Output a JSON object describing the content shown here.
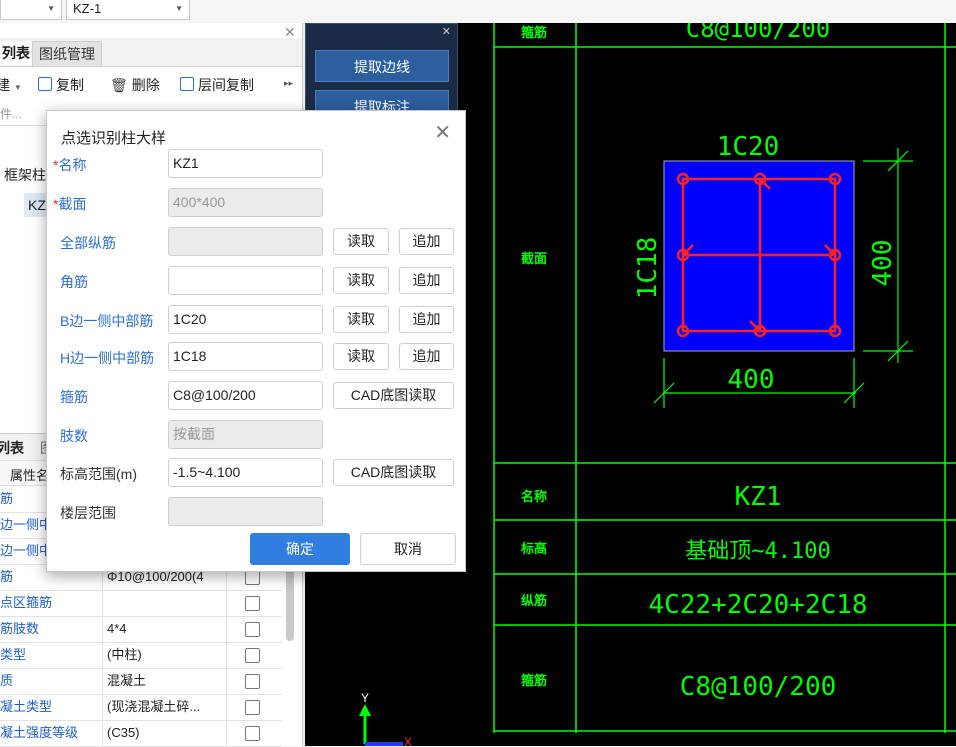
{
  "topbar": {
    "combo1_value": "",
    "combo2_value": "KZ-1"
  },
  "left_panel": {
    "tabs": [
      "列表",
      "图纸管理"
    ],
    "toolbar": [
      "建",
      "复制",
      "删除",
      "层间复制"
    ],
    "search_placeholder": "件...",
    "tree": {
      "group": "框架柱",
      "item": "KZ"
    },
    "tabs2": [
      "列表",
      "图"
    ],
    "prop_header": "属性名",
    "props": [
      {
        "name": "筋",
        "value": "",
        "checked": false
      },
      {
        "name": "边一侧中",
        "value": "",
        "checked": false
      },
      {
        "name": "边一侧中",
        "value": "",
        "checked": false
      },
      {
        "name": "筋",
        "value": "Φ10@100/200(4",
        "checked": false
      },
      {
        "name": "点区箍筋",
        "value": "",
        "checked": false
      },
      {
        "name": "筋肢数",
        "value": "4*4",
        "checked": false
      },
      {
        "name": "类型",
        "value": "(中柱)",
        "checked": false
      },
      {
        "name": "质",
        "value": "混凝土",
        "checked": false
      },
      {
        "name": "凝土类型",
        "value": "(现浇混凝土碎...",
        "checked": false
      },
      {
        "name": "凝土强度等级",
        "value": "(C35)",
        "checked": false
      }
    ]
  },
  "mid_panel": {
    "buttons": [
      "提取边线",
      "提取标注"
    ]
  },
  "dialog": {
    "title": "点选识别柱大样",
    "fields": [
      {
        "label": "名称",
        "required": true,
        "value": "KZ1",
        "disabled": false
      },
      {
        "label": "截面",
        "required": true,
        "value": "400*400",
        "disabled": true
      },
      {
        "label": "全部纵筋",
        "required": false,
        "value": "",
        "disabled": true
      },
      {
        "label": "角筋",
        "required": false,
        "value": "",
        "disabled": false
      },
      {
        "label": "B边一侧中部筋",
        "required": false,
        "value": "1C20",
        "disabled": false
      },
      {
        "label": "H边一侧中部筋",
        "required": false,
        "value": "1C18",
        "disabled": false
      },
      {
        "label": "箍筋",
        "required": false,
        "value": "C8@100/200",
        "disabled": false
      },
      {
        "label": "肢数",
        "required": false,
        "value": "按截面",
        "disabled": true
      },
      {
        "label": "标高范围(m)",
        "required": false,
        "value": "-1.5~4.100",
        "disabled": false
      },
      {
        "label": "楼层范围",
        "required": false,
        "value": "",
        "disabled": true
      }
    ],
    "read_label": "读取",
    "append_label": "追加",
    "cad_read_label": "CAD底图读取",
    "ok_label": "确定",
    "cancel_label": "取消"
  },
  "cad": {
    "top_text": "C8@100/200",
    "b_bar": "1C20",
    "h_bar": "1C18",
    "dim_w": "400",
    "dim_h": "400",
    "row_labels": [
      "箍筋",
      "截面",
      "名称",
      "标高",
      "纵筋",
      "箍筋"
    ],
    "name": "KZ1",
    "elev": "基础顶~4.100",
    "long_bars": "4C22+2C20+2C18",
    "stirrup": "C8@100/200",
    "axis_y": "Y",
    "axis_x": "X",
    "colors": {
      "line": "#00ff00",
      "fill": "#0000ff",
      "rebar": "#ff2020"
    }
  }
}
